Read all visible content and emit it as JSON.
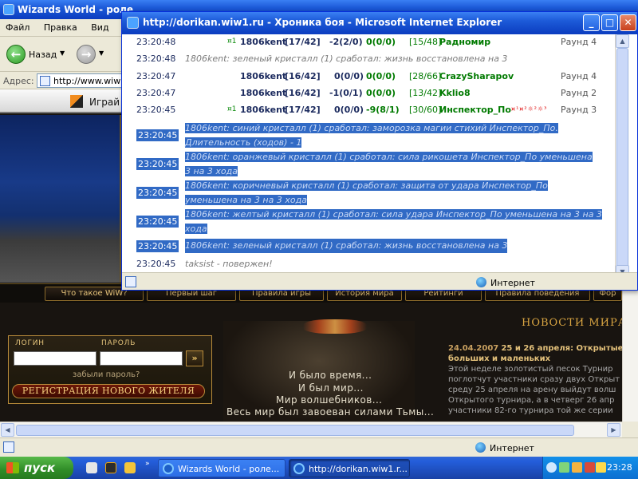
{
  "bg_window": {
    "title": "Wizards World - роле",
    "menu": [
      "Файл",
      "Правка",
      "Вид",
      "И"
    ],
    "toolbar": {
      "back_label": "Назад"
    },
    "address": {
      "label": "Адрес:",
      "url": "http://www.wiw1"
    }
  },
  "page": {
    "play_label": "Играй",
    "nav": [
      "Что такое WiW?",
      "Первый шаг",
      "Правила игры",
      "История мира",
      "Рейтинги",
      "Правила поведения",
      "Фор"
    ],
    "login": {
      "login_label": "ЛОГИН",
      "password_label": "ПАРОЛЬ",
      "forgot": "забыли пароль?",
      "go": "»",
      "register": "РЕГИСТРАЦИЯ НОВОГО ЖИТЕЛЯ"
    },
    "news": {
      "heading": "НОВОСТИ МИРА",
      "date": "24.04.2007",
      "headline": "25 и 26 апреля: Открытые",
      "headline2": "больших и маленьких",
      "body": [
        "Этой неделе золотистый песок Турнир",
        "поглотчут участники сразу двух Открыт",
        "среду 25 апреля на арену выйдут волш",
        "Открытого турнира, а в четверг 26 апр",
        "участники 82-го турнира той же серии"
      ]
    },
    "tagline": [
      "И было время...",
      "И был мир...",
      "Мир волшебников...",
      "Весь мир был завоеван силами Тьмы..."
    ]
  },
  "status_zone": "Интернет",
  "popup": {
    "title": "http://dorikan.wiw1.ru - Хроника боя - Microsoft Internet Explorer",
    "log": {
      "r1": {
        "time": "23:20:48",
        "mark": "¤1",
        "name": "1806kent",
        "hp": "[17/42]",
        "v1": "-2(2/0)",
        "v2": "0(0/0)",
        "opp_hp": "[15/48]",
        "opp": "Радномир",
        "round": "Раунд 4"
      },
      "r2": {
        "time": "23:20:48",
        "text": "1806kent: зеленый кристалл (1) сработал: жизнь восстановлена на 3"
      },
      "r3": {
        "time": "23:20:47",
        "name": "1806kent",
        "hp": "[16/42]",
        "v1": "0(0/0)",
        "v2": "0(0/0)",
        "opp_hp": "[28/66]",
        "opp": "CrazySharapov",
        "round": "Раунд 4"
      },
      "r4": {
        "time": "23:20:47",
        "name": "1806kent",
        "hp": "[16/42]",
        "v1": "-1(0/1)",
        "v2": "0(0/0)",
        "opp_hp": "[13/42]",
        "opp": "Kklio8",
        "round": "Раунд 2"
      },
      "r5": {
        "time": "23:20:45",
        "mark": "¤1",
        "name": "1806kent",
        "hp": "[17/42]",
        "v1": "0(0/0)",
        "v2": "-9(8/1)",
        "opp_hp": "[30/60]",
        "opp": "Инспектор_По",
        "icons": "¤¹¤²☼²☼³",
        "round": "Раунд 3"
      },
      "r6": {
        "time": "23:20:45",
        "line1": "1806kent: синий кристалл (1) сработал: заморозка магии стихий Инспектор_По.",
        "line2": "Длительность (ходов) - 1"
      },
      "r7": {
        "time": "23:20:45",
        "line1": "1806kent: оранжевый кристалл (1) сработал: сила рикошета Инспектор_По уменьшена",
        "line2": "3 на 3 хода"
      },
      "r8": {
        "time": "23:20:45",
        "line1": "1806kent: коричневый кристалл (1) сработал: защита от удара Инспектор_По",
        "line2": "уменьшена на 3 на 3 хода"
      },
      "r9": {
        "time": "23:20:45",
        "line1": "1806kent: желтый кристалл (1) сработал: сила удара Инспектор_По уменьшена на 3 на 3",
        "line2": "хода"
      },
      "r10": {
        "time": "23:20:45",
        "text": "1806kent: зеленый кристалл (1) сработал: жизнь восстановлена на 3"
      },
      "r11": {
        "time": "23:20:45",
        "text": "taksist - повержен!"
      }
    }
  },
  "taskbar": {
    "start": "пуск",
    "task1": "Wizards World - роле...",
    "task2": "http://dorikan.wiw1.r...",
    "clock": "23:28"
  },
  "colors": {
    "xp_blue": "#0b3cbf",
    "highlight": "#316ac5",
    "green_value": "#007a00",
    "page_gold": "#d9a542"
  }
}
